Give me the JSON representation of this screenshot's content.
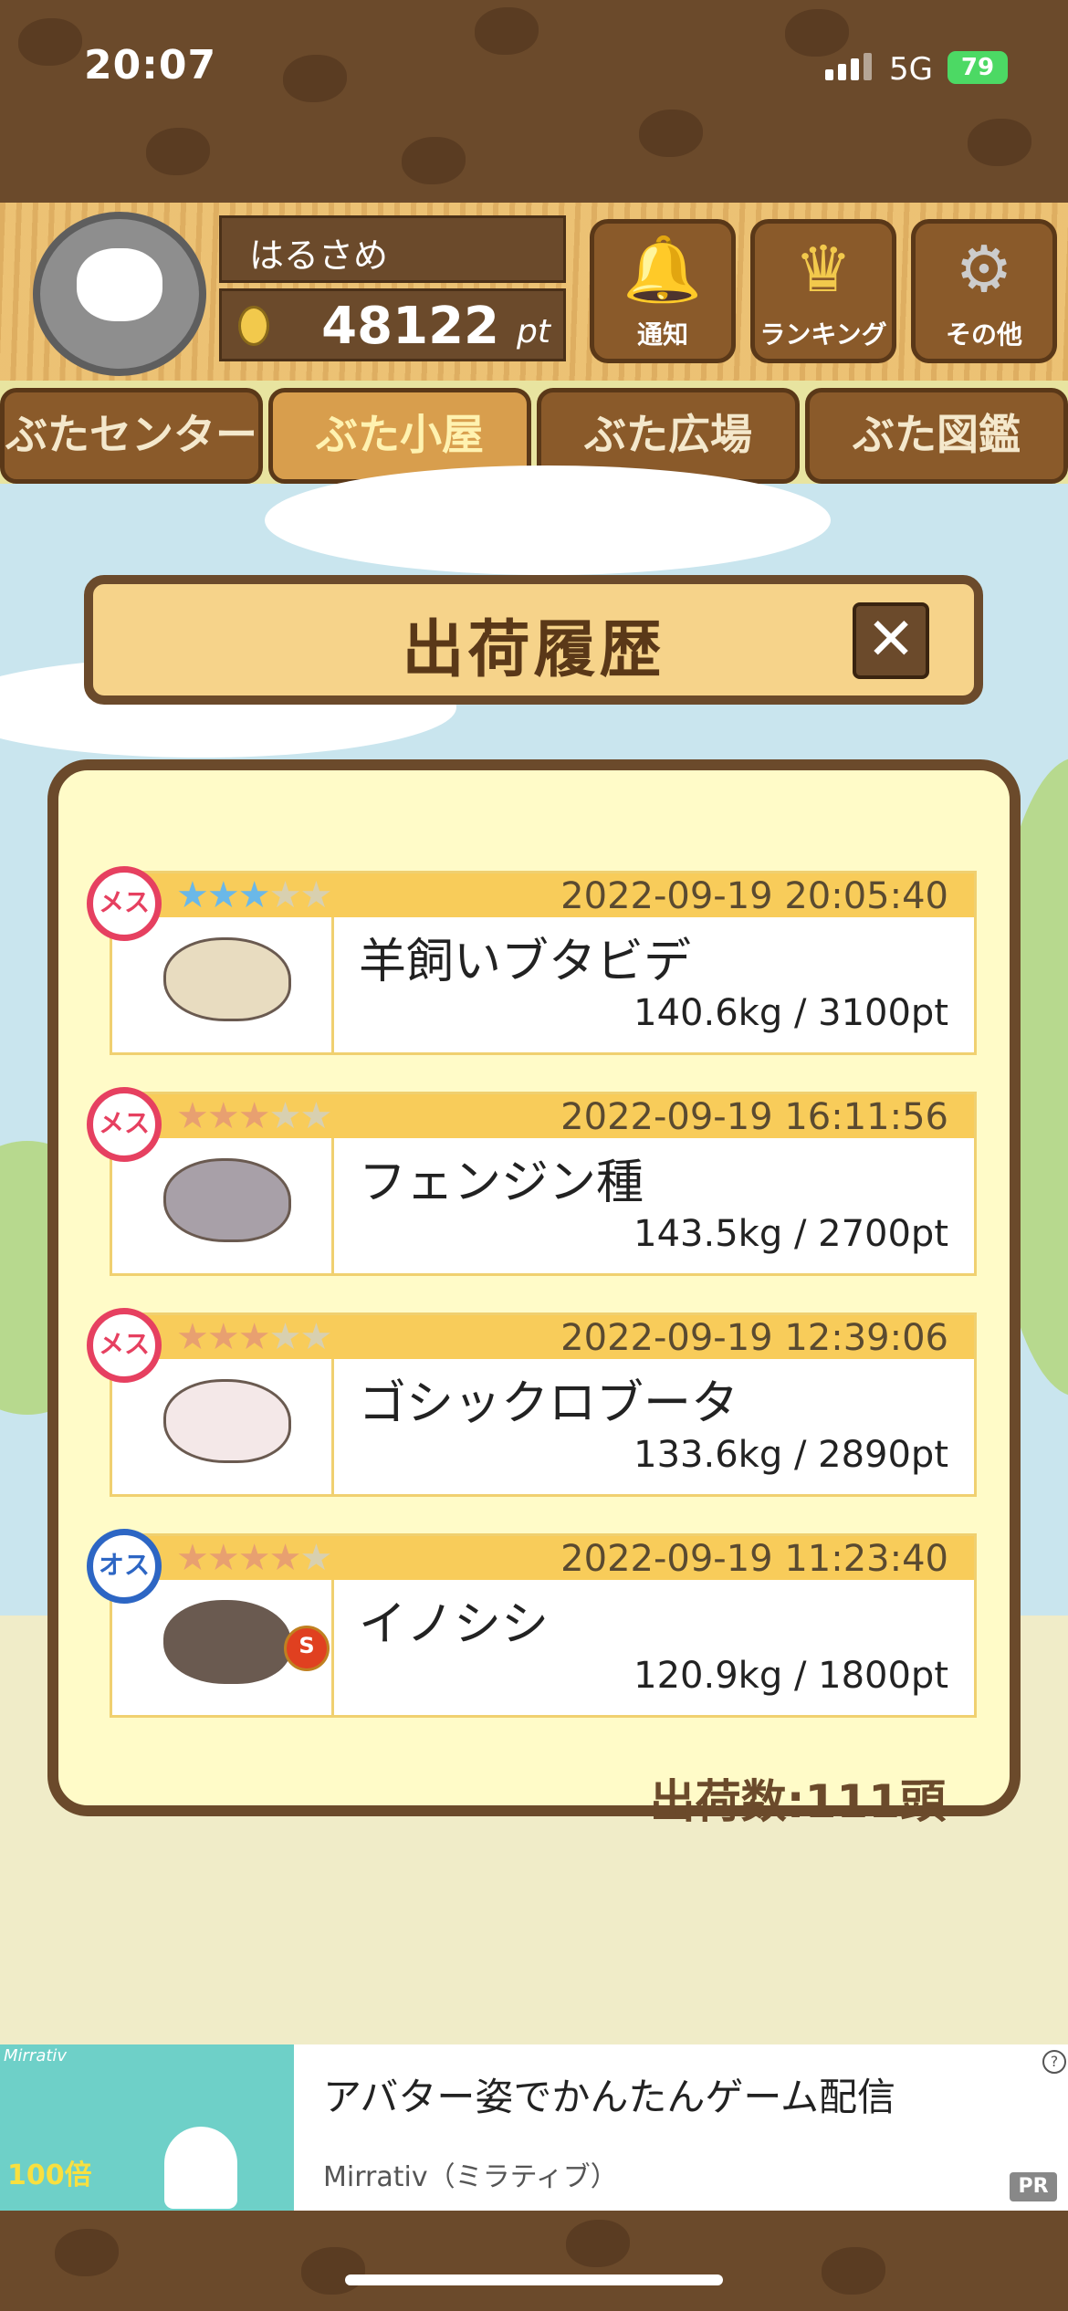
{
  "status_bar": {
    "time": "20:07",
    "network": "5G",
    "battery": "79"
  },
  "header": {
    "username": "はるさめ",
    "points": "48122",
    "points_unit": "pt",
    "buttons": [
      {
        "label": "通知",
        "icon": "bell-icon"
      },
      {
        "label": "ランキング",
        "icon": "crown-icon"
      },
      {
        "label": "その他",
        "icon": "gear-icon"
      }
    ]
  },
  "tabs": [
    {
      "label": "ぶたセンター",
      "active": false
    },
    {
      "label": "ぶた小屋",
      "active": true
    },
    {
      "label": "ぶた広場",
      "active": false
    },
    {
      "label": "ぶた図鑑",
      "active": false
    }
  ],
  "dialog": {
    "title": "出荷履歴",
    "close": "✕",
    "entries": [
      {
        "gender": "メス",
        "gender_type": "female",
        "stars": 3,
        "date": "2022-09-19 20:05:40",
        "name": "羊飼いブタビデ",
        "weight": "140.6kg / 3100pt",
        "star_color": "#6ab8e8",
        "medal": false
      },
      {
        "gender": "メス",
        "gender_type": "female",
        "stars": 3,
        "date": "2022-09-19 16:11:56",
        "name": "フェンジン種",
        "weight": "143.5kg / 2700pt",
        "star_color": "#e8a070",
        "medal": false
      },
      {
        "gender": "メス",
        "gender_type": "female",
        "stars": 3,
        "date": "2022-09-19 12:39:06",
        "name": "ゴシックロブータ",
        "weight": "133.6kg / 2890pt",
        "star_color": "#e8a070",
        "medal": false
      },
      {
        "gender": "オス",
        "gender_type": "male",
        "stars": 4,
        "date": "2022-09-19 11:23:40",
        "name": "イノシシ",
        "weight": "120.9kg / 1800pt",
        "star_color": "#e8a070",
        "medal": true,
        "medal_label": "S"
      }
    ],
    "count_label": "出荷数:111頭"
  },
  "ad": {
    "title": "アバター姿でかんたんゲーム配信",
    "subtitle": "Mirrativ（ミラティブ）",
    "pr": "PR",
    "info": "?",
    "brand": "Mirrativ",
    "promo": "100倍"
  }
}
